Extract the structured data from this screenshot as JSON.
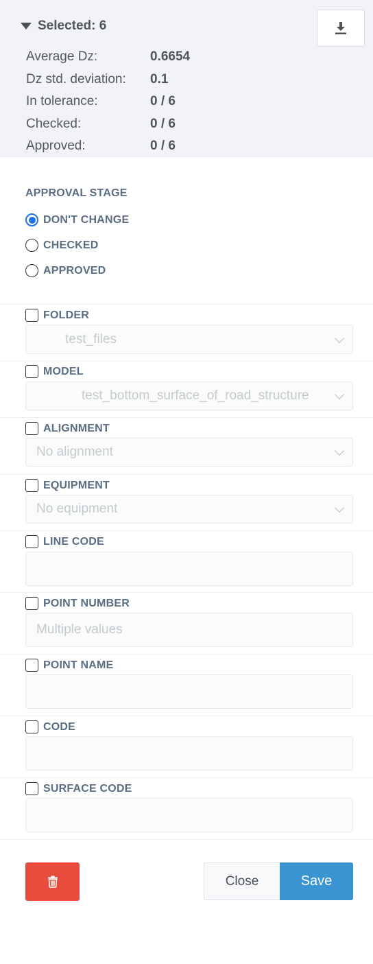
{
  "summary": {
    "title": "Selected: 6",
    "rows": [
      {
        "label": "Average Dz:",
        "value": "0.6654"
      },
      {
        "label": "Dz std. deviation:",
        "value": "0.1"
      },
      {
        "label": "In tolerance:",
        "value": "0 / 6"
      },
      {
        "label": "Checked:",
        "value": "0 / 6"
      },
      {
        "label": "Approved:",
        "value": "0 / 6"
      }
    ],
    "download_icon": "download-icon"
  },
  "approval": {
    "title": "APPROVAL STAGE",
    "options": [
      {
        "label": "DON'T CHANGE",
        "selected": true
      },
      {
        "label": "CHECKED",
        "selected": false
      },
      {
        "label": "APPROVED",
        "selected": false
      }
    ]
  },
  "fields": {
    "folder": {
      "label": "FOLDER",
      "value": "test_files"
    },
    "model": {
      "label": "MODEL",
      "value": "test_bottom_surface_of_road_structure"
    },
    "alignment": {
      "label": "ALIGNMENT",
      "value": "No alignment"
    },
    "equipment": {
      "label": "EQUIPMENT",
      "value": "No equipment"
    },
    "line_code": {
      "label": "LINE CODE",
      "value": ""
    },
    "point_number": {
      "label": "POINT NUMBER",
      "placeholder": "Multiple values"
    },
    "point_name": {
      "label": "POINT NAME",
      "value": ""
    },
    "code": {
      "label": "CODE",
      "value": ""
    },
    "surface_code": {
      "label": "SURFACE CODE",
      "value": ""
    }
  },
  "actions": {
    "delete_icon": "trash-icon",
    "close_label": "Close",
    "save_label": "Save"
  },
  "colors": {
    "summary_bg": "#f2f3f8",
    "label": "#5a6d82",
    "radio_selected": "#1a73e8",
    "delete": "#e84c3d",
    "save": "#3a94d1"
  }
}
